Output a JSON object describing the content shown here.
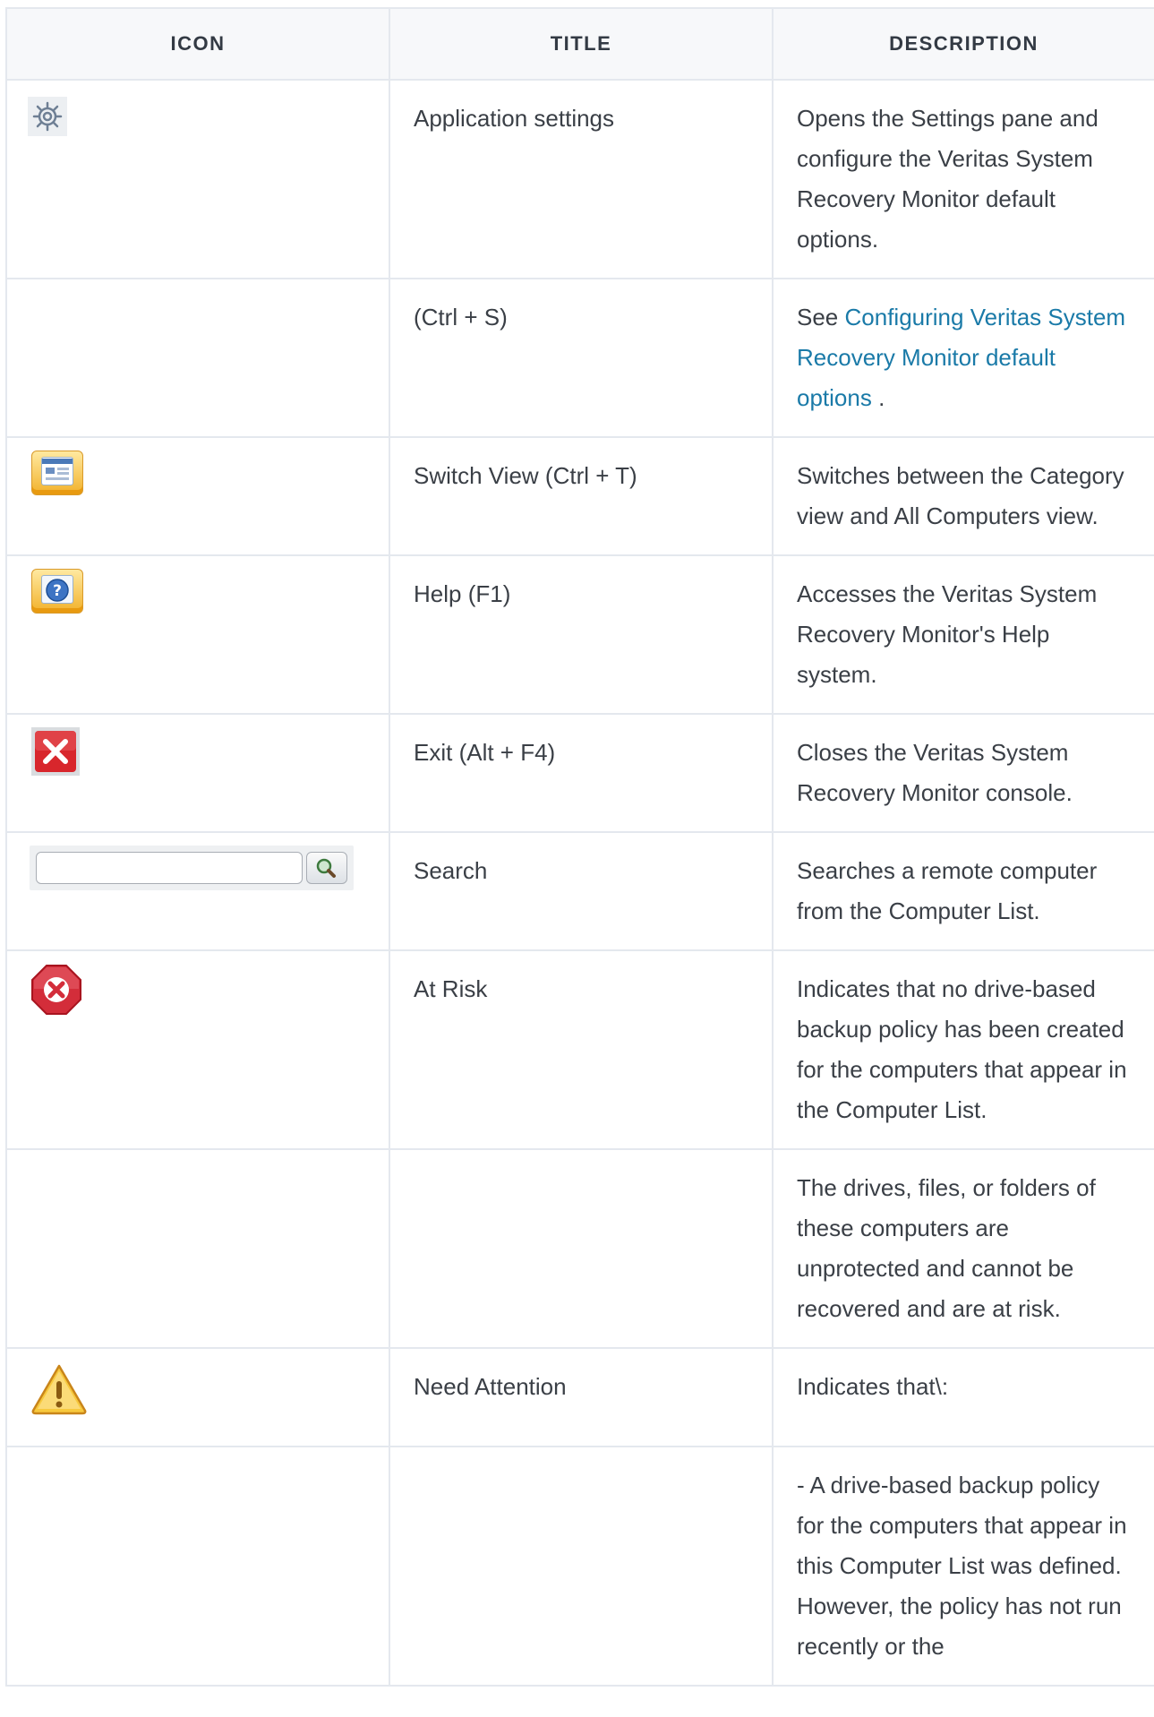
{
  "table": {
    "headers": [
      "ICON",
      "TITLE",
      "DESCRIPTION"
    ],
    "rows": [
      {
        "icon": "gear-icon",
        "title": "Application settings",
        "description": "Opens the Settings pane and configure the Veritas System Recovery Monitor default options."
      },
      {
        "icon": "",
        "title": "(Ctrl + S)",
        "description_prefix": "See ",
        "description_link": "Configuring Veritas System Recovery Monitor default options",
        "description_suffix": " ."
      },
      {
        "icon": "switch-view-icon",
        "title": "Switch View (Ctrl + T)",
        "description": "Switches between the Category view and All Computers view."
      },
      {
        "icon": "help-icon",
        "title": "Help (F1)",
        "description": "Accesses the Veritas System Recovery Monitor's Help system."
      },
      {
        "icon": "exit-icon",
        "title": "Exit (Alt + F4)",
        "description": "Closes the Veritas System Recovery Monitor console."
      },
      {
        "icon": "search-box-icon",
        "title": "Search",
        "description": "Searches a remote computer from the Computer List."
      },
      {
        "icon": "at-risk-icon",
        "title": "At Risk",
        "description": "Indicates that no drive-based backup policy has been created for the computers that appear in the Computer List."
      },
      {
        "icon": "",
        "title": "",
        "description": "The drives, files, or folders of these computers are unprotected and cannot be recovered and are at risk."
      },
      {
        "icon": "warning-icon",
        "title": "Need Attention",
        "description": "Indicates that\\:"
      },
      {
        "icon": "",
        "title": "",
        "description": "- A drive-based backup policy for the computers that appear in this Computer List was defined. However, the policy has not run recently or the"
      }
    ]
  },
  "colors": {
    "border": "#e4e8ee",
    "header_bg": "#f7f8fa",
    "link": "#1a7aa8",
    "text": "#3a3f46"
  }
}
